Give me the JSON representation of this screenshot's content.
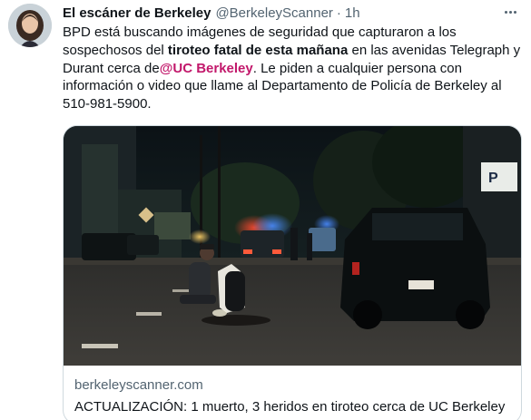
{
  "author": {
    "display_name": "El escáner de Berkeley",
    "handle": "@BerkeleyScanner",
    "separator": "·",
    "time": "1h"
  },
  "tweet": {
    "text_1": "BPD está buscando imágenes de seguridad que capturaron a los sospechosos del ",
    "text_bold": "tiroteo fatal de esta mañana",
    "text_2": " en las avenidas Telegraph y Durant cerca de",
    "mention": "@UC Berkeley",
    "text_3": ". Le piden a cualquier persona con información o video que llame al Departamento de Policía de Berkeley al 510-981-5900."
  },
  "card": {
    "domain": "berkeleyscanner.com",
    "title": "ACTUALIZACIÓN: 1 muerto, 3 heridos en tiroteo cerca de UC Berkeley",
    "street_sign": "P"
  },
  "icons": {
    "more": "more-horizontal-icon"
  },
  "colors": {
    "mention": "#c2186b",
    "secondary_text": "#536471",
    "card_border": "#cfd9de"
  }
}
